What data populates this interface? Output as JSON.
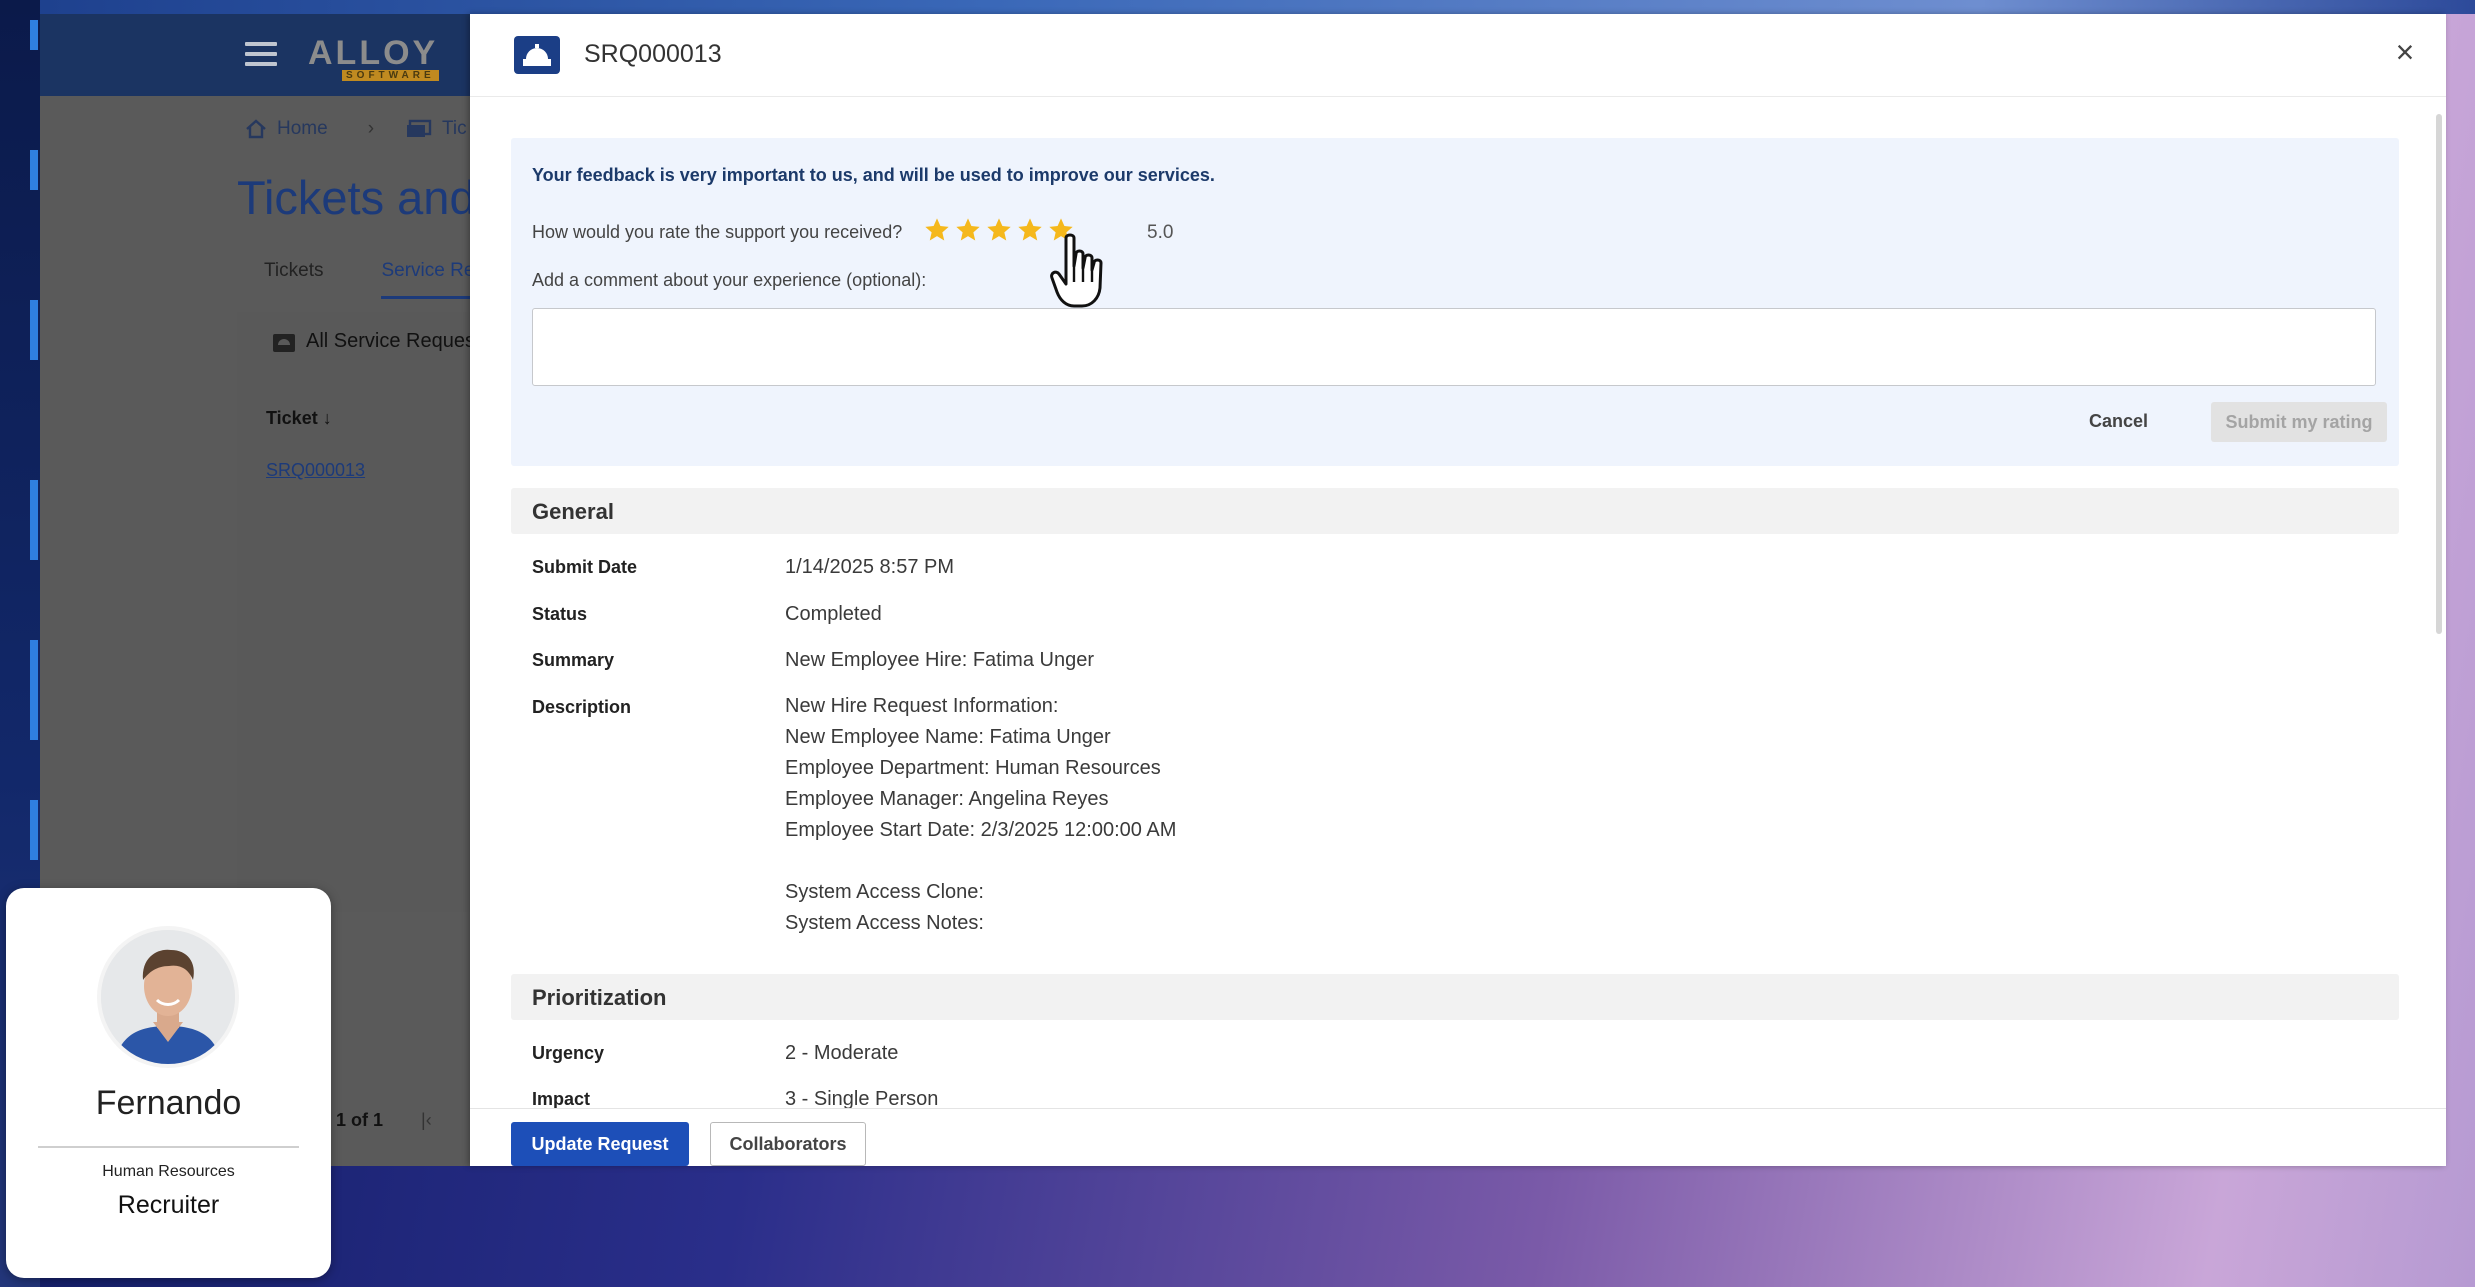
{
  "background_app": {
    "logo_text": "ALLOY",
    "logo_sub": "SOFTWARE",
    "breadcrumb": {
      "home": "Home",
      "next": "Tic"
    },
    "page_title": "Tickets and",
    "tabs": [
      "Tickets",
      "Service Rec"
    ],
    "panel_title": "All Service Reques",
    "column_header": "Ticket",
    "ticket_link": "SRQ000013",
    "pager_text": "1 of 1"
  },
  "modal": {
    "title": "SRQ000013",
    "close_icon": "close-icon",
    "feedback": {
      "intro": "Your feedback is very important to us, and will be used to improve our services.",
      "question": "How would you rate the support you received?",
      "rating": 5,
      "rating_label": "5.0",
      "max_stars": 5,
      "star_color": "#f5b81c",
      "comment_label": "Add a comment about your experience (optional):",
      "comment_value": "",
      "cancel_label": "Cancel",
      "submit_label": "Submit my rating"
    },
    "general": {
      "heading": "General",
      "submit_date_label": "Submit Date",
      "submit_date": "1/14/2025 8:57 PM",
      "status_label": "Status",
      "status": "Completed",
      "summary_label": "Summary",
      "summary": "New Employee Hire: Fatima Unger",
      "description_label": "Description",
      "description": "New Hire Request Information:\nNew Employee Name: Fatima Unger\nEmployee Department: Human Resources\nEmployee Manager: Angelina Reyes\nEmployee Start Date: 2/3/2025 12:00:00 AM\n\nSystem Access Clone:\nSystem Access Notes:"
    },
    "prioritization": {
      "heading": "Prioritization",
      "urgency_label": "Urgency",
      "urgency": "2 - Moderate",
      "impact_label": "Impact",
      "impact": "3 - Single Person"
    },
    "footer": {
      "update_label": "Update Request",
      "collaborators_label": "Collaborators"
    },
    "accent_color": "#1d4fb8"
  },
  "profile_card": {
    "name": "Fernando",
    "department": "Human Resources",
    "role": "Recruiter"
  }
}
